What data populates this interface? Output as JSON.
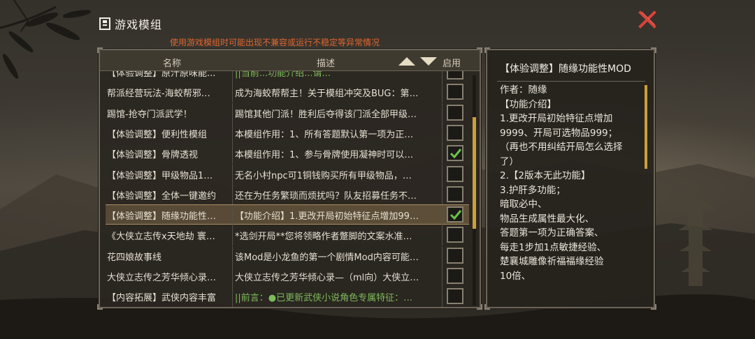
{
  "window": {
    "title": "游戏模组",
    "warning": "使用游戏模组时可能出现不兼容或运行不稳定等异常情况"
  },
  "table": {
    "headers": {
      "name": "名称",
      "desc": "描述",
      "enable": "启用"
    },
    "rows": [
      {
        "name": "【体验调整】原汁原味能...",
        "desc": "||当前...功能介绍...请...",
        "enabled": false,
        "desc_green": true,
        "selected": false
      },
      {
        "name": "帮派经营玩法-海蛟帮邪…",
        "desc": "成为海蛟帮帮主！关于模组冲突及BUG：第…",
        "enabled": false,
        "desc_green": false,
        "selected": false
      },
      {
        "name": "踢馆-抢夺门派武学！",
        "desc": "踢馆其他门派！胜利后夺得该门派全部甲级…",
        "enabled": false,
        "desc_green": false,
        "selected": false
      },
      {
        "name": "【体验调整】便利性模组",
        "desc": "本模组作用：1、所有答题默认第一项为正…",
        "enabled": false,
        "desc_green": false,
        "selected": false
      },
      {
        "name": "【体验调整】骨牌透视",
        "desc": "本模组作用：1、参与骨牌使用凝神时可以…",
        "enabled": true,
        "desc_green": false,
        "selected": false
      },
      {
        "name": "【体验调整】甲级物品1…",
        "desc": "无名小村npc可1铜钱购买所有甲级物品，…",
        "enabled": false,
        "desc_green": false,
        "selected": false
      },
      {
        "name": "【体验调整】全体一键邀约",
        "desc": "还在为任务繁琐而烦扰吗？队友招募任务不…",
        "enabled": false,
        "desc_green": false,
        "selected": false
      },
      {
        "name": "【体验调整】随缘功能性…",
        "desc": "【功能介绍】1.更改开局初始特征点增加99…",
        "enabled": true,
        "desc_green": false,
        "selected": true
      },
      {
        "name": "《大侠立志传x天地劫 寰…",
        "desc": "*选剑开局**您将领略作者蹩脚的文案水准…",
        "enabled": false,
        "desc_green": false,
        "selected": false
      },
      {
        "name": "花四娘故事线",
        "desc": "该Mod是小龙鱼的第一个剧情Mod内容可能…",
        "enabled": false,
        "desc_green": false,
        "selected": false
      },
      {
        "name": "大侠立志传之芳华倾心录…",
        "desc": "大侠立志传之芳华倾心录—（ml向）大侠立…",
        "enabled": false,
        "desc_green": false,
        "selected": false
      },
      {
        "name": "【内容拓展】武侠内容丰富",
        "desc": "||前言：●已更新武侠小说角色专属特征：…",
        "enabled": false,
        "desc_green": true,
        "selected": false
      }
    ]
  },
  "detail": {
    "title": "【体验调整】随缘功能性MOD",
    "lines": [
      "作者：随缘",
      "【功能介绍】",
      "1.更改开局初始特征点增加",
      "9999、开局可选物品999；",
      "（再也不用纠结开局怎么选择",
      "了）",
      "2.【2版本无此功能】",
      "3.护肝多功能；",
      "暗取必中、",
      "物品生成属性最大化、",
      "答题第一项为正确答案、",
      "每走1步加1点敏捷经验、",
      "楚襄城雕像祈福福缘经验",
      "10倍、"
    ]
  },
  "colors": {
    "warning": "#e0662e",
    "accent_gold": "#c9a03a",
    "check_green": "#6bc24a",
    "close_red": "#d8433a"
  },
  "icons": {
    "close": "close-icon",
    "sort_up": "triangle-up-icon",
    "sort_down": "triangle-down-icon",
    "title": "mod-book-icon",
    "check": "checkmark-icon"
  }
}
